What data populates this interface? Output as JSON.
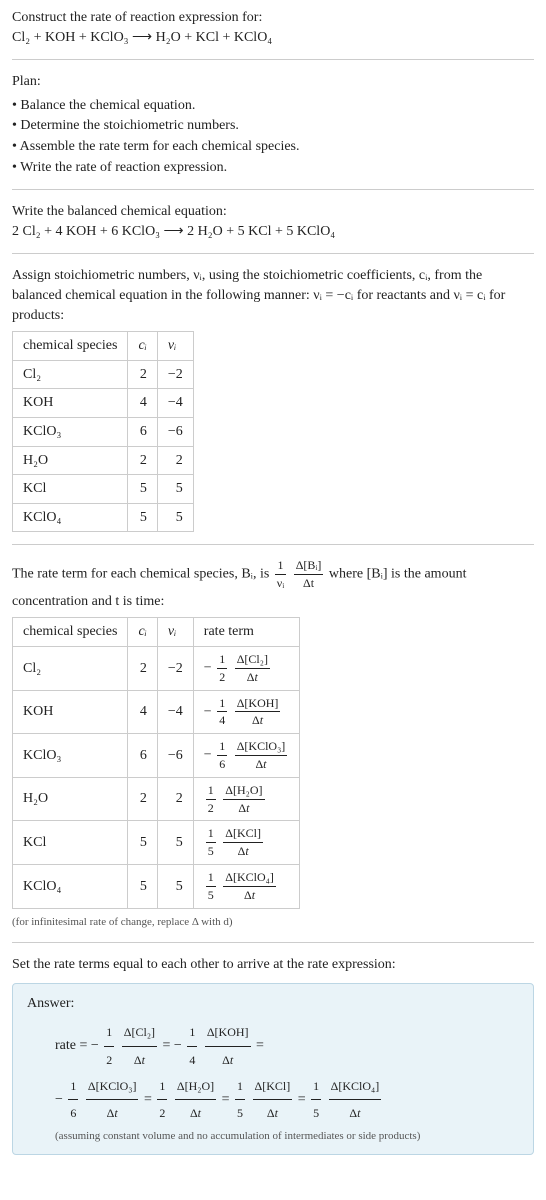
{
  "header": {
    "title": "Construct the rate of reaction expression for:",
    "equation": "Cl₂ + KOH + KClO₃  ⟶  H₂O + KCl + KClO₄"
  },
  "plan": {
    "title": "Plan:",
    "items": [
      "• Balance the chemical equation.",
      "• Determine the stoichiometric numbers.",
      "• Assemble the rate term for each chemical species.",
      "• Write the rate of reaction expression."
    ]
  },
  "balanced": {
    "title": "Write the balanced chemical equation:",
    "equation": "2 Cl₂ + 4 KOH + 6 KClO₃  ⟶  2 H₂O + 5 KCl + 5 KClO₄"
  },
  "stoich_intro_1": "Assign stoichiometric numbers, νᵢ, using the stoichiometric coefficients, cᵢ, from the balanced chemical equation in the following manner: νᵢ = −cᵢ for reactants and νᵢ = cᵢ for products:",
  "table1": {
    "headers": [
      "chemical species",
      "cᵢ",
      "νᵢ"
    ],
    "rows": [
      [
        "Cl₂",
        "2",
        "−2"
      ],
      [
        "KOH",
        "4",
        "−4"
      ],
      [
        "KClO₃",
        "6",
        "−6"
      ],
      [
        "H₂O",
        "2",
        "2"
      ],
      [
        "KCl",
        "5",
        "5"
      ],
      [
        "KClO₄",
        "5",
        "5"
      ]
    ]
  },
  "rate_term_intro_a": "The rate term for each chemical species, Bᵢ, is ",
  "rate_term_frac_top": "1",
  "rate_term_frac_bot": "νᵢ",
  "rate_term_frac2_top": "Δ[Bᵢ]",
  "rate_term_frac2_bot": "Δt",
  "rate_term_intro_b": " where [Bᵢ] is the amount concentration and t is time:",
  "table2": {
    "headers": [
      "chemical species",
      "cᵢ",
      "νᵢ",
      "rate term"
    ],
    "rows": [
      {
        "sp": "Cl₂",
        "c": "2",
        "v": "−2",
        "sign": "−",
        "den": "2",
        "num": "Δ[Cl₂]"
      },
      {
        "sp": "KOH",
        "c": "4",
        "v": "−4",
        "sign": "−",
        "den": "4",
        "num": "Δ[KOH]"
      },
      {
        "sp": "KClO₃",
        "c": "6",
        "v": "−6",
        "sign": "−",
        "den": "6",
        "num": "Δ[KClO₃]"
      },
      {
        "sp": "H₂O",
        "c": "2",
        "v": "2",
        "sign": "",
        "den": "2",
        "num": "Δ[H₂O]"
      },
      {
        "sp": "KCl",
        "c": "5",
        "v": "5",
        "sign": "",
        "den": "5",
        "num": "Δ[KCl]"
      },
      {
        "sp": "KClO₄",
        "c": "5",
        "v": "5",
        "sign": "",
        "den": "5",
        "num": "Δ[KClO₄]"
      }
    ]
  },
  "note": "(for infinitesimal rate of change, replace Δ with d)",
  "final_intro": "Set the rate terms equal to each other to arrive at the rate expression:",
  "answer": {
    "label": "Answer:",
    "line1_prefix": "rate = ",
    "terms": [
      {
        "sign": "−",
        "den": "2",
        "num": "Δ[Cl₂]"
      },
      {
        "sign": "−",
        "den": "4",
        "num": "Δ[KOH]"
      },
      {
        "sign": "−",
        "den": "6",
        "num": "Δ[KClO₃]"
      },
      {
        "sign": "",
        "den": "2",
        "num": "Δ[H₂O]"
      },
      {
        "sign": "",
        "den": "5",
        "num": "Δ[KCl]"
      },
      {
        "sign": "",
        "den": "5",
        "num": "Δ[KClO₄]"
      }
    ],
    "assumption": "(assuming constant volume and no accumulation of intermediates or side products)"
  },
  "chart_data": {
    "type": "table",
    "tables": [
      {
        "title": "Stoichiometric numbers",
        "columns": [
          "chemical species",
          "c_i",
          "nu_i"
        ],
        "rows": [
          [
            "Cl2",
            2,
            -2
          ],
          [
            "KOH",
            4,
            -4
          ],
          [
            "KClO3",
            6,
            -6
          ],
          [
            "H2O",
            2,
            2
          ],
          [
            "KCl",
            5,
            5
          ],
          [
            "KClO4",
            5,
            5
          ]
        ]
      },
      {
        "title": "Rate terms",
        "columns": [
          "chemical species",
          "c_i",
          "nu_i",
          "rate term"
        ],
        "rows": [
          [
            "Cl2",
            2,
            -2,
            "-(1/2) d[Cl2]/dt"
          ],
          [
            "KOH",
            4,
            -4,
            "-(1/4) d[KOH]/dt"
          ],
          [
            "KClO3",
            6,
            -6,
            "-(1/6) d[KClO3]/dt"
          ],
          [
            "H2O",
            2,
            2,
            "(1/2) d[H2O]/dt"
          ],
          [
            "KCl",
            5,
            5,
            "(1/5) d[KCl]/dt"
          ],
          [
            "KClO4",
            5,
            5,
            "(1/5) d[KClO4]/dt"
          ]
        ]
      }
    ]
  }
}
